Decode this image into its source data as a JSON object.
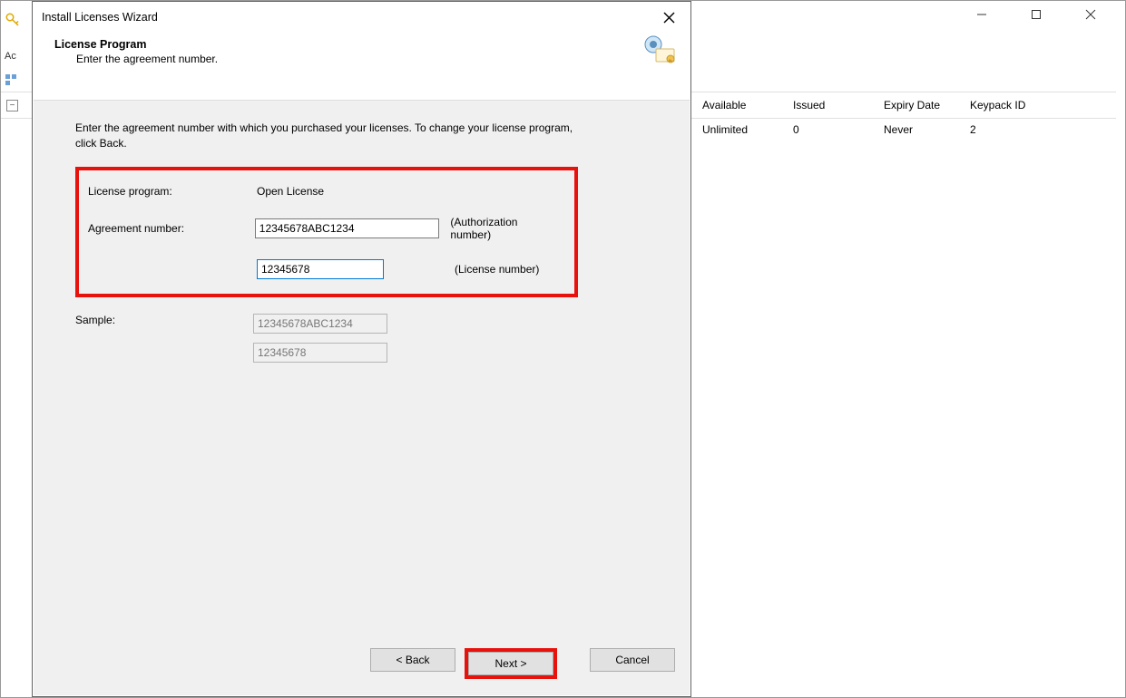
{
  "parent_window": {
    "partial_label_left": "Ac"
  },
  "dialog": {
    "title": "Install Licenses Wizard",
    "subhead_title": "License Program",
    "subhead_desc": "Enter the agreement number.",
    "instruction": "Enter the agreement number with which you purchased your licenses. To change your license program, click Back.",
    "labels": {
      "license_program": "License program:",
      "agreement_number": "Agreement number:",
      "sample": "Sample:"
    },
    "values": {
      "license_program": "Open License",
      "authorization_number": "12345678ABC1234",
      "license_number": "12345678"
    },
    "hints": {
      "authorization": "(Authorization number)",
      "license": "(License number)"
    },
    "samples": {
      "authorization": "12345678ABC1234",
      "license": "12345678"
    },
    "buttons": {
      "back": "< Back",
      "next": "Next >",
      "cancel": "Cancel"
    }
  },
  "grid": {
    "columns": {
      "available": "Available",
      "issued": "Issued",
      "expiry": "Expiry Date",
      "keypack": "Keypack ID"
    },
    "row": {
      "available": "Unlimited",
      "issued": "0",
      "expiry": "Never",
      "keypack": "2"
    }
  },
  "highlight_color": "#e8120c"
}
